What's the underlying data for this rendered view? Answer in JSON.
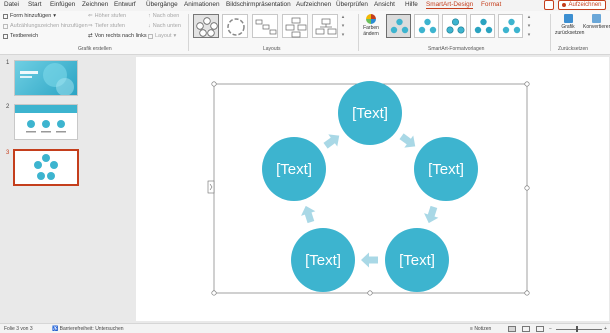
{
  "menu": {
    "tabs": [
      "Datei",
      "Start",
      "Einfügen",
      "Zeichnen",
      "Entwurf",
      "Übergänge",
      "Animationen",
      "Bildschirmpräsentation",
      "Aufzeichnen",
      "Überprüfen",
      "Ansicht",
      "Hilfe",
      "SmartArt-Design",
      "Format"
    ],
    "active_tab": "SmartArt-Design",
    "record_label": "Aufzeichnen"
  },
  "ribbon": {
    "grafik_erstellen": {
      "form_hinzufuegen": "Form hinzufügen",
      "aufzaehlungszeichen": "Aufzählungszeichen hinzufügen",
      "textbereich": "Textbereich",
      "hoeher_stufen": "Höher stufen",
      "tiefer_stufen": "Tiefer stufen",
      "von_rechts_nach_links": "Von rechts nach links",
      "nach_oben": "Nach oben",
      "nach_unten": "Nach unten",
      "layout": "Layout",
      "group_label": "Grafik erstellen"
    },
    "layouts_label": "Layouts",
    "farben": {
      "line1": "Farben",
      "line2": "ändern"
    },
    "formatvorlagen_label": "SmartArt-Formatvorlagen",
    "zuruecksetzen": {
      "line1": "Grafik",
      "line2": "zurücksetzen",
      "group_label": "Zurücksetzen"
    },
    "konvertieren": {
      "line1": "Konvertieren"
    }
  },
  "slides": [
    {
      "number": "1"
    },
    {
      "number": "2"
    },
    {
      "number": "3"
    }
  ],
  "smartart": {
    "nodes": [
      "[Text]",
      "[Text]",
      "[Text]",
      "[Text]",
      "[Text]"
    ],
    "node_color": "#3db4cf",
    "arrow_color": "#a9d8e6"
  },
  "status": {
    "slide_info": "Folie 3 von 3",
    "accessibility": "Barrierefreiheit: Untersuchen",
    "notes": "Notizen"
  },
  "colors": {
    "accent": "#c43e1c"
  }
}
